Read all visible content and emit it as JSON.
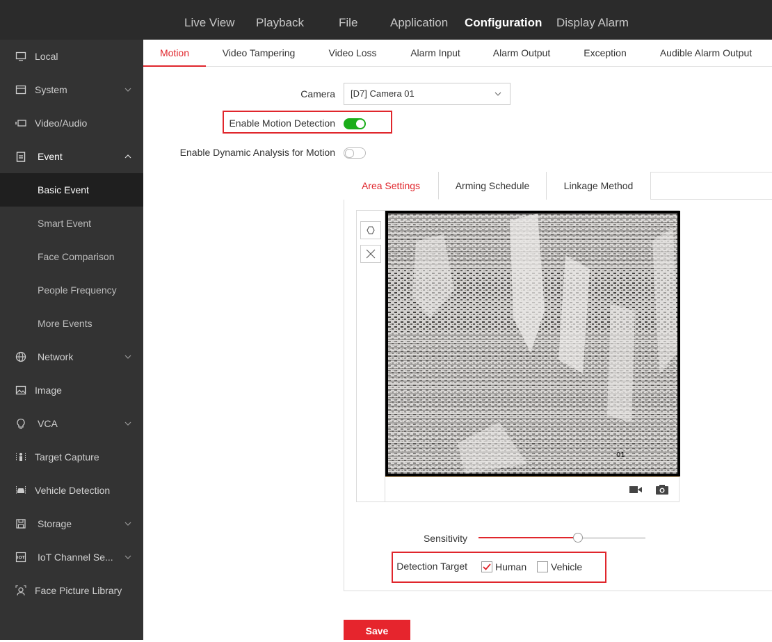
{
  "topnav": {
    "items": [
      "Live View",
      "Playback",
      "File",
      "Application",
      "Configuration",
      "Display Alarm"
    ],
    "active": "Configuration"
  },
  "sidebar": {
    "items": [
      {
        "label": "Local",
        "icon": "monitor-icon"
      },
      {
        "label": "System",
        "icon": "window-icon",
        "expandable": true
      },
      {
        "label": "Video/Audio",
        "icon": "camera-icon"
      },
      {
        "label": "Event",
        "icon": "clipboard-icon",
        "expanded": true
      },
      {
        "label": "Basic Event",
        "sub": true,
        "active": true
      },
      {
        "label": "Smart Event",
        "sub": true
      },
      {
        "label": "Face Comparison",
        "sub": true
      },
      {
        "label": "People Frequency",
        "sub": true
      },
      {
        "label": "More Events",
        "sub": true
      },
      {
        "label": "Network",
        "icon": "globe-icon",
        "expandable": true
      },
      {
        "label": "Image",
        "icon": "image-icon"
      },
      {
        "label": "VCA",
        "icon": "bulb-icon",
        "expandable": true
      },
      {
        "label": "Target Capture",
        "icon": "person-icon"
      },
      {
        "label": "Vehicle Detection",
        "icon": "car-icon"
      },
      {
        "label": "Storage",
        "icon": "floppy-icon",
        "expandable": true
      },
      {
        "label": "IoT Channel Se...",
        "icon": "iot-icon",
        "expandable": true
      },
      {
        "label": "Face Picture Library",
        "icon": "face-icon"
      }
    ]
  },
  "subtabs": {
    "items": [
      "Motion",
      "Video Tampering",
      "Video Loss",
      "Alarm Input",
      "Alarm Output",
      "Exception",
      "Audible Alarm Output"
    ],
    "active": "Motion"
  },
  "form": {
    "camera_label": "Camera",
    "camera_value": "[D7] Camera 01",
    "enable_motion_label": "Enable Motion Detection",
    "enable_motion_on": true,
    "dynamic_analysis_label": "Enable Dynamic Analysis for Motion",
    "dynamic_analysis_on": false
  },
  "panel": {
    "tabs": [
      "Area Settings",
      "Arming Schedule",
      "Linkage Method"
    ],
    "active_tab": "Area Settings",
    "video_overlay_text": "01",
    "sensitivity_label": "Sensitivity",
    "sensitivity_value": 0.62,
    "detection_target_label": "Detection Target",
    "human_label": "Human",
    "human_checked": true,
    "vehicle_label": "Vehicle",
    "vehicle_checked": false
  },
  "save_label": "Save",
  "colors": {
    "accent": "#e0262c",
    "toggle_on": "#1aad19",
    "sidebar_bg": "#333333",
    "topbar_bg": "#2b2b2b"
  }
}
